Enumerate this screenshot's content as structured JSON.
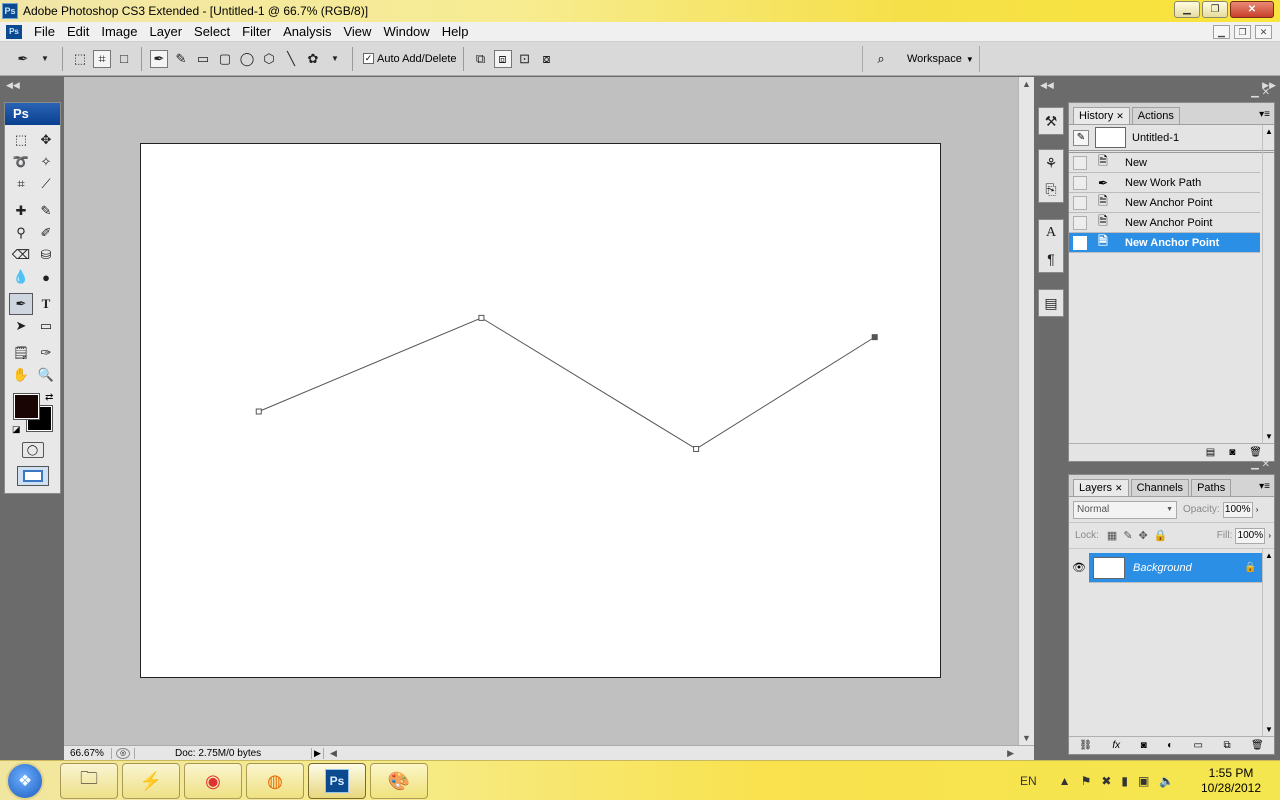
{
  "window": {
    "app_badge": "Ps",
    "title": "Adobe Photoshop CS3 Extended - [Untitled-1 @ 66.7% (RGB/8)]"
  },
  "menu": {
    "doc_badge": "Ps",
    "items": [
      "File",
      "Edit",
      "Image",
      "Layer",
      "Select",
      "Filter",
      "Analysis",
      "View",
      "Window",
      "Help"
    ]
  },
  "options": {
    "auto_add_delete_label": "Auto Add/Delete",
    "auto_add_delete_checked": true,
    "workspace_label": "Workspace"
  },
  "toolbox": {
    "header": "Ps"
  },
  "colors": {
    "foreground": "#1a0505",
    "background": "#000000",
    "selection": "#2b8fe6"
  },
  "canvas": {
    "path_points": [
      [
        0.147,
        0.5
      ],
      [
        0.425,
        0.325
      ],
      [
        0.693,
        0.57
      ],
      [
        0.916,
        0.361
      ]
    ]
  },
  "status": {
    "zoom": "66.67%",
    "doc_info": "Doc: 2.75M/0 bytes"
  },
  "history_panel": {
    "tabs": [
      {
        "label": "History",
        "active": true
      },
      {
        "label": "Actions",
        "active": false
      }
    ],
    "snapshot": "Untitled-1",
    "steps": [
      {
        "label": "New",
        "icon": "history-step-icon",
        "selected": false
      },
      {
        "label": "New Work Path",
        "icon": "pen-icon",
        "selected": false
      },
      {
        "label": "New Anchor Point",
        "icon": "history-step-icon",
        "selected": false
      },
      {
        "label": "New Anchor Point",
        "icon": "history-step-icon",
        "selected": false
      },
      {
        "label": "New Anchor Point",
        "icon": "history-step-icon",
        "selected": true
      }
    ]
  },
  "layers_panel": {
    "tabs": [
      {
        "label": "Layers",
        "active": true
      },
      {
        "label": "Channels",
        "active": false
      },
      {
        "label": "Paths",
        "active": false
      }
    ],
    "blend_mode": "Normal",
    "opacity_label": "Opacity:",
    "opacity_value": "100%",
    "lock_label": "Lock:",
    "fill_label": "Fill:",
    "fill_value": "100%",
    "layers": [
      {
        "name": "Background",
        "visible": true,
        "locked": true,
        "selected": true
      }
    ]
  },
  "taskbar": {
    "ps_label": "Ps",
    "language": "EN",
    "time": "1:55 PM",
    "date": "10/28/2012"
  }
}
